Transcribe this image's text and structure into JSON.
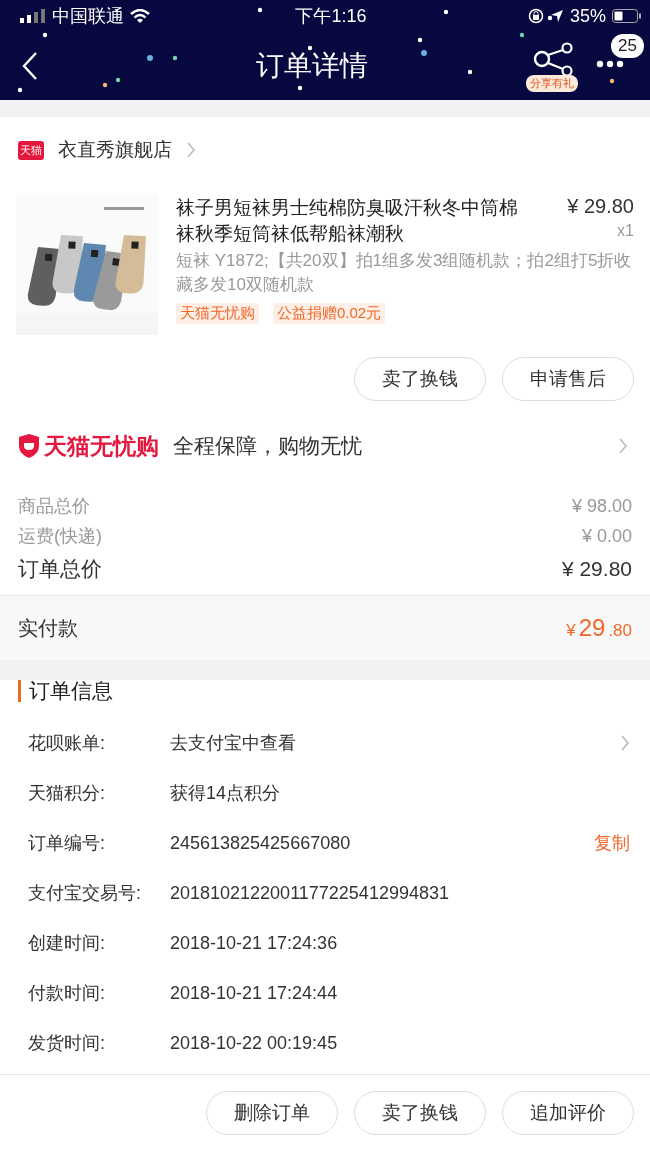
{
  "status_bar": {
    "carrier": "中国联通",
    "time": "下午1:16",
    "battery": "35%"
  },
  "nav": {
    "title": "订单详情",
    "share_label": "分享有礼",
    "message_count": "25"
  },
  "shop": {
    "badge": "天猫",
    "name": "衣直秀旗舰店"
  },
  "product": {
    "image": {
      "kind": "picture"
    },
    "title": "袜子男短袜男士纯棉防臭吸汗秋冬中筒棉袜秋季短筒袜低帮船袜潮秋",
    "price": "¥ 29.80",
    "quantity": "x1",
    "sku": "短袜 Y1872;【共20双】拍1组多发3组随机款；拍2组打5折收藏多发10双随机款",
    "tags": [
      "天猫无忧购",
      "公益捐赠0.02元"
    ]
  },
  "item_buttons": [
    "卖了换钱",
    "申请售后"
  ],
  "guarantee": {
    "brand": "天猫无忧购",
    "text": "全程保障，购物无忧"
  },
  "price_rows": [
    {
      "label": "商品总价",
      "value": "¥ 98.00",
      "kind": "minor"
    },
    {
      "label": "运费(快递)",
      "value": "¥ 0.00",
      "kind": "minor"
    },
    {
      "label": "订单总价",
      "value": "¥ 29.80",
      "kind": "major"
    }
  ],
  "paid": {
    "label": "实付款",
    "currency": "¥",
    "integer": "29",
    "decimal": ".80"
  },
  "order_info": {
    "title": "订单信息",
    "rows": [
      {
        "label": "花呗账单:",
        "value": "去支付宝中查看",
        "kind": "link"
      },
      {
        "label": "天猫积分:",
        "value": "获得14点积分",
        "kind": "text"
      },
      {
        "label": "订单编号:",
        "value": "245613825425667080",
        "kind": "copy",
        "action": "复制"
      },
      {
        "label": "支付宝交易号:",
        "value": "2018102122001177225412994831",
        "kind": "text"
      },
      {
        "label": "创建时间:",
        "value": "2018-10-21 17:24:36",
        "kind": "text"
      },
      {
        "label": "付款时间:",
        "value": "2018-10-21 17:24:44",
        "kind": "text"
      },
      {
        "label": "发货时间:",
        "value": "2018-10-22 00:19:45",
        "kind": "text"
      }
    ]
  },
  "bottom_buttons": [
    "删除订单",
    "卖了换钱",
    "追加评价"
  ]
}
